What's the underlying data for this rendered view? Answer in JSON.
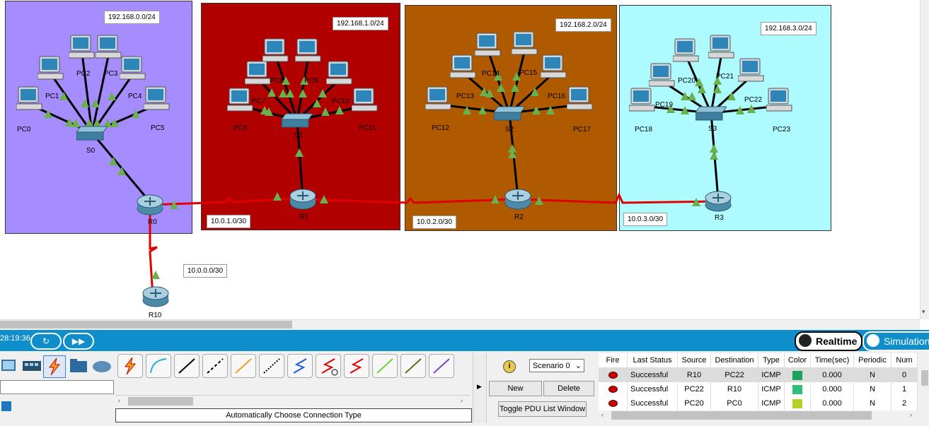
{
  "topology": {
    "networks": [
      {
        "label": "192.168.0.0/24",
        "color": "#a58cff"
      },
      {
        "label": "192.168.1.0/24",
        "color": "#b00000"
      },
      {
        "label": "192.168.2.0/24",
        "color": "#b05a00"
      },
      {
        "label": "192.168.3.0/24",
        "color": "#adfbff"
      }
    ],
    "links": [
      "10.0.1.0/30",
      "10.0.2.0/30",
      "10.0.3.0/30",
      "10.0.0.0/30"
    ],
    "pcs": [
      "PC0",
      "PC1",
      "PC2",
      "PC3",
      "PC4",
      "PC5",
      "PC6",
      "PC7",
      "PC8",
      "PC9",
      "PC10",
      "PC11",
      "PC12",
      "PC13",
      "PC14",
      "PC15",
      "PC16",
      "PC17",
      "PC18",
      "PC19",
      "PC20",
      "PC21",
      "PC22",
      "PC23"
    ],
    "switches": [
      "S0",
      "S1",
      "S2",
      "S3"
    ],
    "routers": [
      "R0",
      "R1",
      "R2",
      "R3",
      "R10"
    ],
    "link_color": "#e00000",
    "port_color": "#6ab04c"
  },
  "toolbar": {
    "time": "28:19:36",
    "realtime_label": "Realtime",
    "simulation_label": "Simulation",
    "accent": "#0e8fcb"
  },
  "connections": {
    "status": "Automatically Choose Connection Type",
    "types": [
      "auto-icon",
      "console-icon",
      "straight-icon",
      "crossover-icon",
      "fiber-icon",
      "phone-icon",
      "coaxial-icon",
      "serial-dce-icon",
      "serial-dte-icon",
      "octal-icon",
      "usb-icon",
      "wireless-icon"
    ]
  },
  "scenario": {
    "selected": "Scenario 0",
    "new_label": "New",
    "delete_label": "Delete",
    "toggle_label": "Toggle PDU List Window"
  },
  "pdu_table": {
    "headers": [
      "Fire",
      "Last Status",
      "Source",
      "Destination",
      "Type",
      "Color",
      "Time(sec)",
      "Periodic",
      "Num"
    ],
    "rows": [
      {
        "status": "Successful",
        "source": "R10",
        "destination": "PC22",
        "type": "ICMP",
        "color": "#1aa35a",
        "time": "0.000",
        "periodic": "N",
        "num": "0"
      },
      {
        "status": "Successful",
        "source": "PC22",
        "destination": "R10",
        "type": "ICMP",
        "color": "#2fbf7a",
        "time": "0.000",
        "periodic": "N",
        "num": "1"
      },
      {
        "status": "Successful",
        "source": "PC20",
        "destination": "PC0",
        "type": "ICMP",
        "color": "#b8cf2a",
        "time": "0.000",
        "periodic": "N",
        "num": "2"
      }
    ]
  }
}
